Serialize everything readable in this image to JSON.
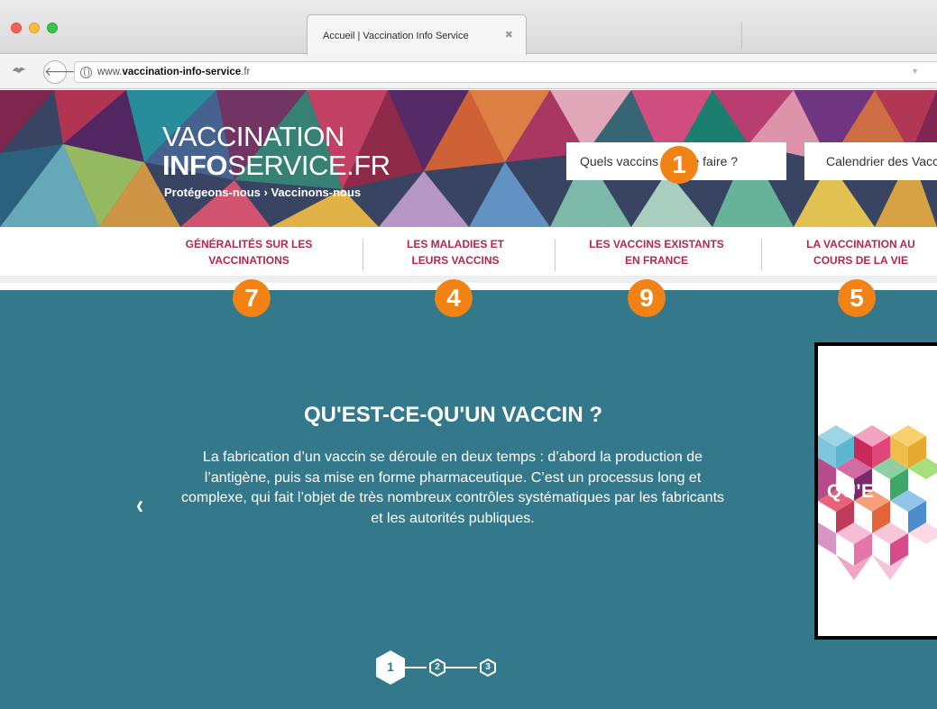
{
  "browser": {
    "tab_title": "Accueil | Vaccination Info Service",
    "tab_close": "✖",
    "url_prefix": "www.",
    "url_domain": "vaccination-info-service",
    "url_suffix": ".fr"
  },
  "header": {
    "logo_line1": "VACCINATION",
    "logo_info": "INFO",
    "logo_service": "SERVICE.FR",
    "tagline": "Protégeons-nous › Vaccinons-nous",
    "search_button": "Quels vaccins dois-je faire ?",
    "calendar_button": "Calendrier des Vaccinations"
  },
  "nav": {
    "items": [
      {
        "line1": "GÉNÉRALITÉS SUR LES",
        "line2": "VACCINATIONS"
      },
      {
        "line1": "LES MALADIES ET",
        "line2": "LEURS VACCINS"
      },
      {
        "line1": "LES VACCINS EXISTANTS",
        "line2": "EN FRANCE"
      },
      {
        "line1": "LA VACCINATION AU",
        "line2": "COURS DE LA VIE"
      }
    ]
  },
  "badges": {
    "search": "1",
    "nav_1": "7",
    "nav_2": "4",
    "nav_3": "9",
    "nav_4": "5"
  },
  "slide": {
    "title": "QU'EST-CE-QU'UN VACCIN ?",
    "body": "La fabrication d’un vaccin se déroule en deux temps : d’abord la production de l’antigène, puis sa mise en forme pharmaceutique. C’est un processus long et complexe, qui fait l’objet de très nombreux contrôles systématiques par les fabricants et les autorités publiques.",
    "image_caption": "QU'E",
    "prev_arrow": "‹"
  },
  "pager": {
    "pages": [
      "1",
      "2",
      "3"
    ],
    "active": 1
  },
  "colors": {
    "accent_nav": "#b4274a",
    "badge": "#f08216",
    "main_bg": "#34788c"
  }
}
